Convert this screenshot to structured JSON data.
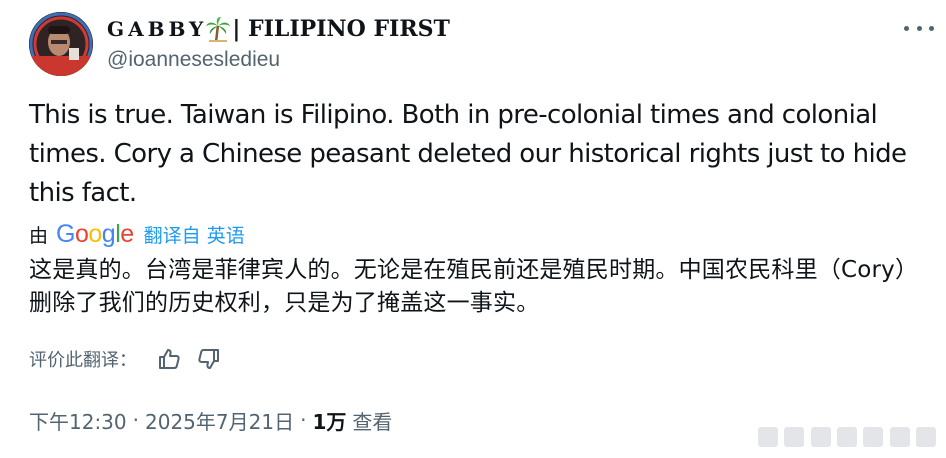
{
  "colors": {
    "text_primary": "#0f1419",
    "text_secondary": "#536471",
    "link": "#1d9bf0"
  },
  "author": {
    "display_name_prefix": "Gabby",
    "display_name_emoji_icon": "palm-tree-icon",
    "display_name_suffix": "| FILIPINO FIRST",
    "handle": "@ioannesesledieu",
    "avatar_icon": "avatar-photo"
  },
  "more_icon": "more-options-icon",
  "tweet": {
    "text": "This is true. Taiwan is Filipino. Both in pre-colonial times and colonial times. Cory a Chinese peasant deleted our historical rights just to hide this fact."
  },
  "translation": {
    "by_label": "由",
    "provider": "Google",
    "link_label": "翻译自 英语",
    "translated_text": "这是真的。台湾是菲律宾人的。无论是在殖民前还是殖民时期。中国农民科里（Cory）删除了我们的历史权利，只是为了掩盖这一事实。"
  },
  "rating": {
    "label": "评价此翻译：",
    "thumbs_up_icon": "thumbs-up-icon",
    "thumbs_down_icon": "thumbs-down-icon"
  },
  "meta": {
    "time": "下午12:30",
    "separator": "·",
    "date": "2025年7月21日",
    "views_count": "1万",
    "views_label": "查看"
  }
}
